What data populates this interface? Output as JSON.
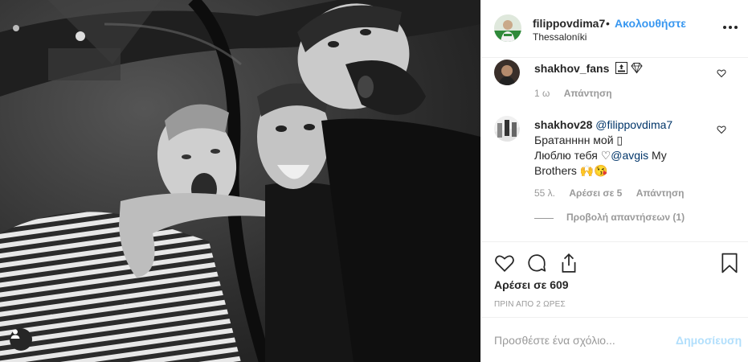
{
  "post": {
    "photo_alt_icon": "user-tag-icon"
  },
  "header": {
    "username": "filippovdima7",
    "separator": "•",
    "follow_label": "Ακολουθήστε",
    "location": "Thessaloníki",
    "more_icon": "more-options-icon"
  },
  "comments": [
    {
      "username": "shakhov_fans",
      "text_suffix": "🔝💎",
      "time": "1 ω",
      "reply_label": "Απάντηση"
    },
    {
      "username": "shakhov28",
      "mention": "@filippovdima7",
      "line1": "Братанннн мой ▯",
      "line2_prefix": "Люблю тебя ♡",
      "mention2": "@avgis",
      "line2_suffix": " My",
      "line3": "Brothers 🙌😘",
      "time": "55 λ.",
      "likes": "Αρέσει σε 5",
      "reply_label": "Απάντηση",
      "view_replies": "Προβολή απαντήσεων (1)"
    }
  ],
  "actions": {
    "like_icon": "heart-icon",
    "comment_icon": "comment-icon",
    "share_icon": "share-icon",
    "save_icon": "bookmark-icon"
  },
  "likes_text": "Αρέσει σε 609",
  "time_ago": "ΠΡΙΝ ΑΠΟ 2 ΩΡΕΣ",
  "composer": {
    "placeholder": "Προσθέστε ένα σχόλιο...",
    "post_label": "Δημοσίευση"
  }
}
